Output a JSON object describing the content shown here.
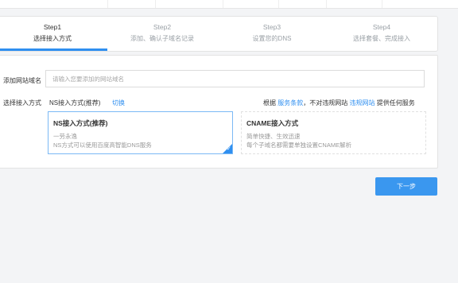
{
  "steps": [
    {
      "num": "Step1",
      "label": "选择接入方式"
    },
    {
      "num": "Step2",
      "label": "添加、确认子域名记录"
    },
    {
      "num": "Step3",
      "label": "设置您的DNS"
    },
    {
      "num": "Step4",
      "label": "选择套餐、完成接入"
    }
  ],
  "form": {
    "domain_label": "添加网站域名",
    "domain_placeholder": "请输入您要添加的网站域名",
    "domain_value": "",
    "method_label": "选择接入方式",
    "method_current": "NS接入方式(推荐)",
    "switch_link": "切换",
    "terms_prefix": "根据",
    "terms_link": "服务条款",
    "terms_middle": "，不对违规网站",
    "violation_link": "违规网站",
    "terms_suffix": "提供任何服务"
  },
  "options": [
    {
      "title": "NS接入方式(推荐)",
      "desc1": "一劳永逸",
      "desc2": "NS方式可以使用百度高智能DNS服务",
      "selected": true
    },
    {
      "title": "CNAME接入方式",
      "desc1": "简单快捷、生效迅速",
      "desc2": "每个子域名都需要单独设置CNAME解析",
      "selected": false
    }
  ],
  "next_button": "下一步",
  "colors": {
    "accent": "#2f8ff0",
    "button": "#3a97ef"
  }
}
